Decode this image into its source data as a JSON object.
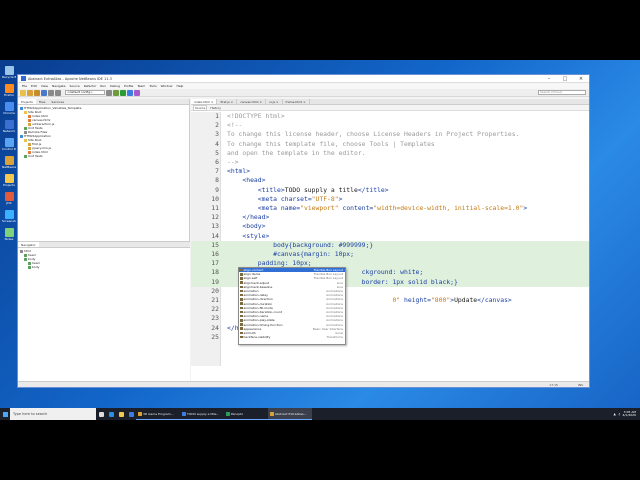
{
  "desktop_icons": [
    {
      "label": "Recycle Bin",
      "color": "#9bc5e8"
    },
    {
      "label": "Firefox",
      "color": "#ff8a1f"
    },
    {
      "label": "Chrome",
      "color": "#4a8df0"
    },
    {
      "label": "Network",
      "color": "#3b6fd1"
    },
    {
      "label": "Control Panel",
      "color": "#5aa4f2"
    },
    {
      "label": "NetBeans",
      "color": "#d9a13a"
    },
    {
      "label": "Projects",
      "color": "#f3c84b"
    },
    {
      "label": "JDK",
      "color": "#e05b3c"
    },
    {
      "label": "Screenshots",
      "color": "#3ab0ff"
    },
    {
      "label": "Notes",
      "color": "#7ed07a"
    }
  ],
  "window": {
    "title": "Abstract ExtraAlias - Apache NetBeans IDE 11.3",
    "menu": [
      "File",
      "Edit",
      "View",
      "Navigate",
      "Source",
      "Refactor",
      "Run",
      "Debug",
      "Profile",
      "Team",
      "Tools",
      "Window",
      "Help"
    ],
    "config_select": "<default config>",
    "search_placeholder": "Search (Ctrl+I)"
  },
  "projects_panel": {
    "tabs": [
      "Projects",
      "Files",
      "Services"
    ],
    "tree": [
      "HTML5Application_Variables_Template",
      "Site Root",
      "index.html",
      "canvas.html",
      "uiInteraction.js",
      "Unit Tests",
      "Remote Files",
      "HTML5Application",
      "Site Root",
      "first.js",
      "jquery.min.js",
      "index.html",
      "Unit Tests"
    ]
  },
  "navigator_panel": {
    "tab": "Navigator",
    "tree": [
      "html",
      "head",
      "body",
      "head",
      "body"
    ]
  },
  "editor": {
    "tabs": [
      "index.html",
      "first.js",
      "canvas.html",
      "ui.js",
      "frame.html"
    ],
    "toolbar": [
      "Source",
      "History"
    ],
    "lines": [
      {
        "n": "1",
        "html": "<span class='cm'>&lt;!DOCTYPE html&gt;</span>"
      },
      {
        "n": "2",
        "html": "<span class='cm'>&lt;!--</span>"
      },
      {
        "n": "3",
        "html": "<span class='cm'>To change this license header, choose License Headers in Project Properties.</span>"
      },
      {
        "n": "4",
        "html": "<span class='cm'>To change this template file, choose Tools | Templates</span>"
      },
      {
        "n": "5",
        "html": "<span class='cm'>and open the template in the editor.</span>"
      },
      {
        "n": "6",
        "html": "<span class='cm'>--&gt;</span>"
      },
      {
        "n": "7",
        "html": "<span class='tg'>&lt;html&gt;</span>"
      },
      {
        "n": "8",
        "html": "    <span class='tg'>&lt;head&gt;</span>"
      },
      {
        "n": "9",
        "html": "        <span class='tg'>&lt;title&gt;</span><span class='pl'>TODO supply a title</span><span class='tg'>&lt;/title&gt;</span>"
      },
      {
        "n": "10",
        "html": "        <span class='tg'>&lt;meta</span> <span class='at'>charset=</span><span class='av'>\"UTF-8\"</span><span class='tg'>&gt;</span>"
      },
      {
        "n": "11",
        "html": "        <span class='tg'>&lt;meta</span> <span class='at'>name=</span><span class='av'>\"viewport\"</span> <span class='at'>content=</span><span class='av'>\"width=device-width, initial-scale=1.0\"</span><span class='tg'>&gt;</span>"
      },
      {
        "n": "12",
        "html": "    <span class='tg'>&lt;/head&gt;</span>"
      },
      {
        "n": "13",
        "html": "    <span class='tg'>&lt;body&gt;</span>"
      },
      {
        "n": "14",
        "html": "    <span class='tg'>&lt;style&gt;</span>"
      },
      {
        "n": "15",
        "html": "            <span class='sel-prop'>body{background: #999999;}</span>",
        "hl": true
      },
      {
        "n": "16",
        "html": "            <span class='sel-prop'>#canvas{margin: 10px;</span>",
        "hl": true
      },
      {
        "n": "17",
        "html": "        <span class='sel-prop'>padding: 10px;</span>",
        "hl": true
      },
      {
        "n": "18",
        "html": "                                   <span class='sel-prop'>ckground: white;</span>",
        "hl": true
      },
      {
        "n": "19",
        "html": "                                   <span class='sel-prop'>border: 1px solid black;}</span>",
        "hl": true
      },
      {
        "n": "20",
        "html": ""
      },
      {
        "n": "21",
        "html": "        <span class='tg'>&lt;ca</span>                                <span class='av'>0\"</span> <span class='at'>height=</span><span class='av'>\"800\"</span><span class='tg'>&gt;</span><span class='pl'>Update</span><span class='tg'>&lt;/canvas&gt;</span>"
      },
      {
        "n": "22",
        "html": ""
      },
      {
        "n": "23",
        "html": "    <span class='tg'>&lt;/b</span>"
      },
      {
        "n": "24",
        "html": "<span class='tg'>&lt;/html&gt;</span>"
      },
      {
        "n": "25",
        "html": ""
      }
    ]
  },
  "autocomplete": {
    "items": [
      {
        "name": "align-content",
        "type": "Flexible Box Layout"
      },
      {
        "name": "align-items",
        "type": "Flexible Box Layout"
      },
      {
        "name": "align-self",
        "type": "Flexible Box Layout"
      },
      {
        "name": "alignment-adjust",
        "type": "Line"
      },
      {
        "name": "alignment-baseline",
        "type": "Line"
      },
      {
        "name": "animation",
        "type": "Animations"
      },
      {
        "name": "animation-delay",
        "type": "Animations"
      },
      {
        "name": "animation-direction",
        "type": "Animations"
      },
      {
        "name": "animation-duration",
        "type": "Animations"
      },
      {
        "name": "animation-fill-mode",
        "type": "Animations"
      },
      {
        "name": "animation-iteration-count",
        "type": "Animations"
      },
      {
        "name": "animation-name",
        "type": "Animations"
      },
      {
        "name": "animation-play-state",
        "type": "Animations"
      },
      {
        "name": "animation-timing-function",
        "type": "Animations"
      },
      {
        "name": "appearance",
        "type": "Basic User Interface"
      },
      {
        "name": "azimuth",
        "type": "Aural"
      },
      {
        "name": "backface-visibility",
        "type": "Transforms"
      }
    ]
  },
  "statusbar": {
    "position": "17:15",
    "mode": "INS"
  },
  "taskbar": {
    "search_placeholder": "Type here to search",
    "apps": [
      {
        "label": "3D Game Program...",
        "color": "#e0a030"
      },
      {
        "label": "TODO supply a title...",
        "color": "#3b7de0"
      },
      {
        "label": "Panopto",
        "color": "#2a9d5c"
      },
      {
        "label": "Abstract ExtraAlias...",
        "color": "#d9a13a"
      }
    ],
    "clock_time": "3:05 AM",
    "clock_date": "4/1/2020"
  }
}
